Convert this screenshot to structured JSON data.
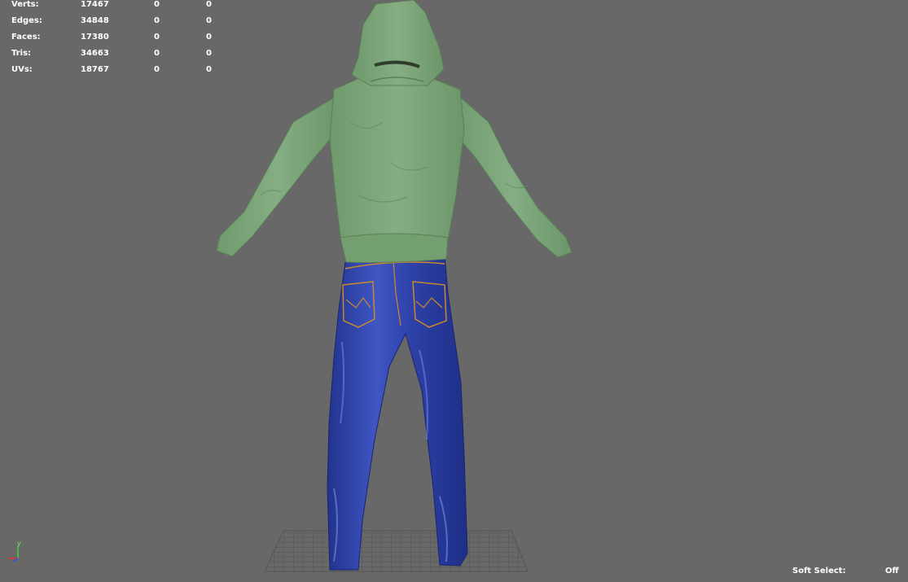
{
  "stats": [
    {
      "label": "Verts:",
      "total": "17467",
      "selected": "0",
      "selected_alt": "0"
    },
    {
      "label": "Edges:",
      "total": "34848",
      "selected": "0",
      "selected_alt": "0"
    },
    {
      "label": "Faces:",
      "total": "17380",
      "selected": "0",
      "selected_alt": "0"
    },
    {
      "label": "Tris:",
      "total": "34663",
      "selected": "0",
      "selected_alt": "0"
    },
    {
      "label": "UVs:",
      "total": "18767",
      "selected": "0",
      "selected_alt": "0"
    }
  ],
  "soft_select": {
    "label": "Soft Select:",
    "value": "Off"
  },
  "axis": {
    "y_label": "y"
  },
  "colors": {
    "background": "#686868",
    "grid": "#555555",
    "hoodie": "#7fa67c",
    "jeans": "#2f43a8",
    "stitching": "#c98a2c",
    "axis_x": "#e03030",
    "axis_y": "#40d040",
    "axis_z": "#3050f0"
  },
  "icons": {
    "axis_gizmo": "xyz-axis-icon"
  }
}
